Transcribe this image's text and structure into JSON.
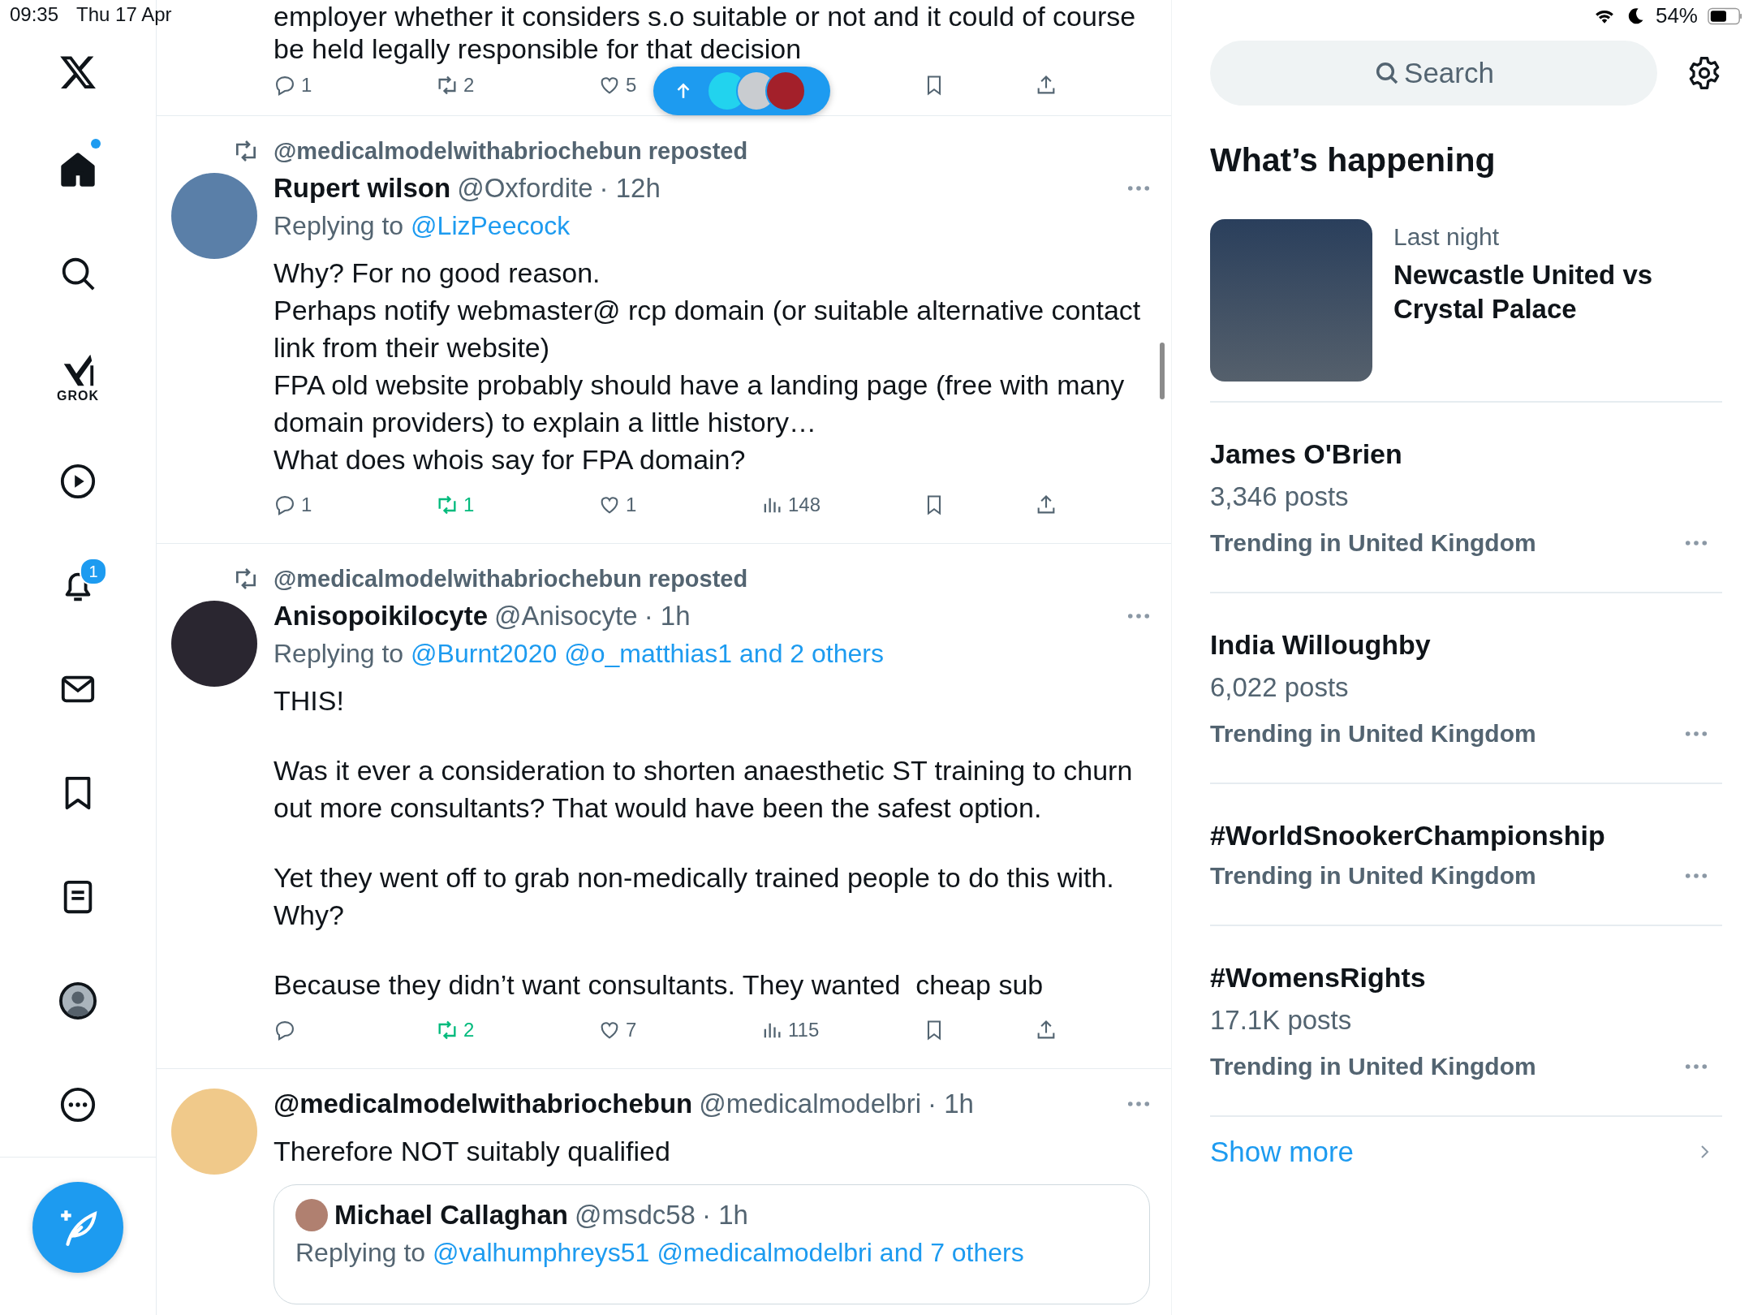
{
  "status_bar": {
    "time": "09:35",
    "date": "Thu 17 Apr",
    "battery": "54%"
  },
  "sidebar": {
    "nav": [
      {
        "kind": "home",
        "selected": true,
        "unread_dot": true
      },
      {
        "kind": "search",
        "selected": false
      },
      {
        "kind": "grok",
        "label": "GROK",
        "selected": false
      },
      {
        "kind": "video",
        "selected": false
      },
      {
        "kind": "notifications",
        "selected": false,
        "badge": "1"
      },
      {
        "kind": "messages",
        "selected": false
      },
      {
        "kind": "bookmarks",
        "selected": false
      },
      {
        "kind": "lists",
        "selected": false
      },
      {
        "kind": "profile",
        "selected": false
      },
      {
        "kind": "more",
        "selected": false
      }
    ]
  },
  "feed": {
    "posts": [
      {
        "paragraphs": [
          [
            "employer whether it considers s.o suitable or not and it could of course",
            "be held legally responsible for that decision"
          ]
        ],
        "actions": {
          "replies": "1",
          "reposts": "2",
          "reposted": false,
          "likes": "5"
        }
      },
      {
        "reposted_by": "@medicalmodelwithabriochebun reposted",
        "name": "Rupert wilson",
        "handle": "@Oxfordite",
        "time": "· 12h",
        "replying_label": "Replying to",
        "replying_to": [
          "@LizPeecock"
        ],
        "paragraphs": [
          [
            "Why? For no good reason.",
            "Perhaps notify webmaster@ rcp domain (or suitable alternative contact link from their website)",
            "FPA old website probably should have a landing page (free with many domain providers) to explain a little history…",
            "What does whois say for FPA domain?"
          ]
        ],
        "actions": {
          "replies": "1",
          "reposts": "1",
          "reposted": true,
          "likes": "1",
          "views": "148"
        }
      },
      {
        "reposted_by": "@medicalmodelwithabriochebun reposted",
        "name": "Anisopoikilocyte",
        "handle": "@Anisocyte",
        "time": "· 1h",
        "replying_label": "Replying to",
        "replying_to": [
          "@Burnt2020",
          "@o_matthias1",
          "and 2 others"
        ],
        "paragraphs": [
          [
            "THIS!"
          ],
          [
            "Was it ever a consideration to shorten anaesthetic ST training to churn out more consultants? That would have been the safest option."
          ],
          [
            "Yet they went off to grab non-medically trained people to do this with. Why?"
          ],
          [
            "Because they didn’t want consultants. They wanted  cheap sub"
          ]
        ],
        "actions": {
          "reposts": "2",
          "reposted": true,
          "likes": "7",
          "views": "115"
        }
      },
      {
        "name": "@medicalmodelwithabriochebun",
        "handle": "@medicalmodelbri",
        "time": "· 1h",
        "paragraphs": [
          [
            "Therefore NOT suitably qualified"
          ]
        ],
        "quote": {
          "name": "Michael Callaghan",
          "handle": "@msdc58",
          "time": "· 1h",
          "replying_label": "Replying to",
          "replying_to": [
            "@valhumphreys51",
            "@medicalmodelbri",
            "and 7 others"
          ]
        }
      }
    ]
  },
  "right": {
    "search": {
      "placeholder": "Search"
    },
    "heading": "What’s happening",
    "featured": {
      "meta": "Last night",
      "title": "Newcastle United vs Crystal Palace"
    },
    "trends": [
      {
        "title": "James O'Brien",
        "posts": "3,346 posts",
        "context": "Trending in United Kingdom"
      },
      {
        "title": "India Willoughby",
        "posts": "6,022 posts",
        "context": "Trending in United Kingdom"
      },
      {
        "title": "#WorldSnookerChampionship",
        "context": "Trending in United Kingdom"
      },
      {
        "title": "#WomensRights",
        "posts": "17.1K posts",
        "context": "Trending in United Kingdom"
      }
    ],
    "show_more": "Show more"
  }
}
